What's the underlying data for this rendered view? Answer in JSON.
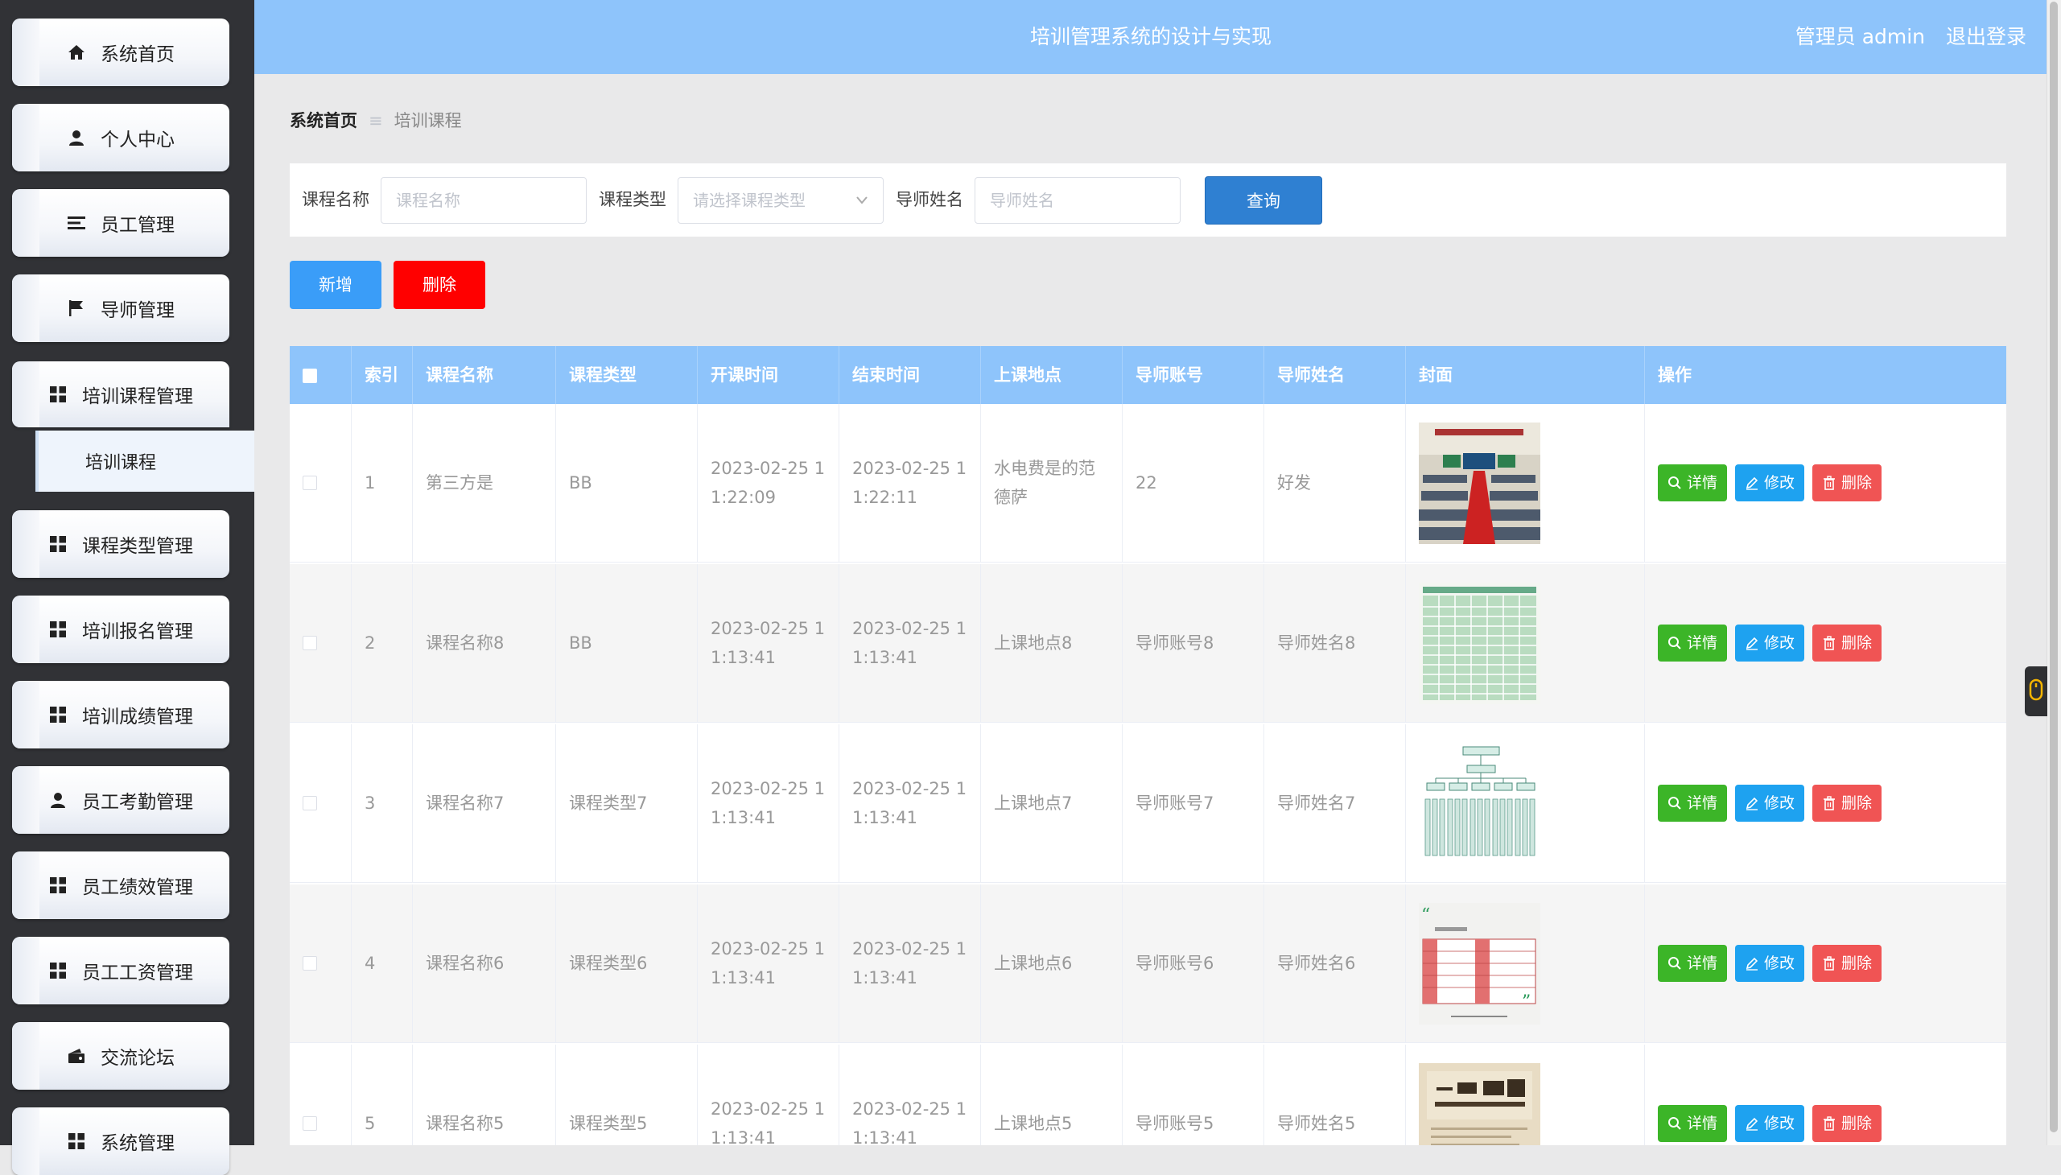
{
  "sidebar": {
    "items": [
      {
        "label": "系统首页",
        "icon": "home-icon"
      },
      {
        "label": "个人中心",
        "icon": "user-icon"
      },
      {
        "label": "员工管理",
        "icon": "list-icon"
      },
      {
        "label": "导师管理",
        "icon": "flag-icon"
      },
      {
        "label": "培训课程管理",
        "icon": "grid-icon"
      },
      {
        "label": "课程类型管理",
        "icon": "grid-icon"
      },
      {
        "label": "培训报名管理",
        "icon": "grid-icon"
      },
      {
        "label": "培训成绩管理",
        "icon": "grid-icon"
      },
      {
        "label": "员工考勤管理",
        "icon": "user-icon"
      },
      {
        "label": "员工绩效管理",
        "icon": "grid-icon"
      },
      {
        "label": "员工工资管理",
        "icon": "grid-icon"
      },
      {
        "label": "交流论坛",
        "icon": "wallet-icon"
      },
      {
        "label": "系统管理",
        "icon": "grid-icon"
      }
    ],
    "sub_item": "培训课程"
  },
  "header": {
    "title": "培训管理系统的设计与实现",
    "user": "管理员 admin",
    "logout": "退出登录"
  },
  "breadcrumb": {
    "home": "系统首页",
    "current": "培训课程"
  },
  "search": {
    "name_label": "课程名称",
    "name_placeholder": "课程名称",
    "type_label": "课程类型",
    "type_placeholder": "请选择课程类型",
    "mentor_label": "导师姓名",
    "mentor_placeholder": "导师姓名",
    "query": "查询"
  },
  "actions": {
    "add": "新增",
    "delete": "删除"
  },
  "table": {
    "headers": [
      "索引",
      "课程名称",
      "课程类型",
      "开课时间",
      "结束时间",
      "上课地点",
      "导师账号",
      "导师姓名",
      "封面",
      "操作"
    ],
    "op_labels": {
      "detail": "详情",
      "edit": "修改",
      "delete": "删除"
    },
    "rows": [
      {
        "index": "1",
        "name": "第三方是",
        "type": "BB",
        "start_a": "2023-02-25 1",
        "start_b": "1:22:09",
        "end_a": "2023-02-25 1",
        "end_b": "1:22:11",
        "place_a": "水电费是的范",
        "place_b": "德萨",
        "account": "22",
        "mentor": "好发",
        "cover": "classroom"
      },
      {
        "index": "2",
        "name": "课程名称8",
        "type": "BB",
        "start_a": "2023-02-25 1",
        "start_b": "1:13:41",
        "end_a": "2023-02-25 1",
        "end_b": "1:13:41",
        "place_a": "上课地点8",
        "place_b": "",
        "account": "导师账号8",
        "mentor": "导师姓名8",
        "cover": "green-table"
      },
      {
        "index": "3",
        "name": "课程名称7",
        "type": "课程类型7",
        "start_a": "2023-02-25 1",
        "start_b": "1:13:41",
        "end_a": "2023-02-25 1",
        "end_b": "1:13:41",
        "place_a": "上课地点7",
        "place_b": "",
        "account": "导师账号7",
        "mentor": "导师姓名7",
        "cover": "org-chart"
      },
      {
        "index": "4",
        "name": "课程名称6",
        "type": "课程类型6",
        "start_a": "2023-02-25 1",
        "start_b": "1:13:41",
        "end_a": "2023-02-25 1",
        "end_b": "1:13:41",
        "place_a": "上课地点6",
        "place_b": "",
        "account": "导师账号6",
        "mentor": "导师姓名6",
        "cover": "plan-table"
      },
      {
        "index": "5",
        "name": "课程名称5",
        "type": "课程类型5",
        "start_a": "2023-02-25 1",
        "start_b": "1:13:41",
        "end_a": "2023-02-25 1",
        "end_b": "1:13:41",
        "place_a": "上课地点5",
        "place_b": "",
        "account": "导师账号5",
        "mentor": "导师姓名5",
        "cover": "book-cover"
      }
    ]
  },
  "colors": {
    "header": "#8ec4fb",
    "query": "#2f80d2",
    "add": "#3a9df8",
    "delete": "#ff0000",
    "detail": "#3cb528",
    "edit": "#1ea2f0",
    "remove": "#f05454"
  }
}
